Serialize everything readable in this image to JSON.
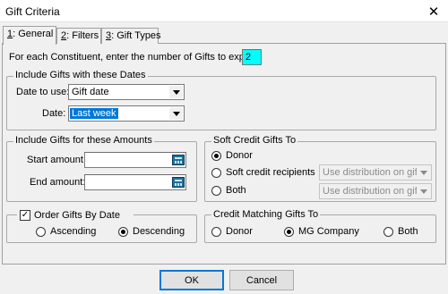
{
  "window": {
    "title": "Gift Criteria"
  },
  "tabs": [
    {
      "key": "1",
      "rest": ": General"
    },
    {
      "key": "2",
      "rest": ": Filters"
    },
    {
      "key": "3",
      "rest": ": Gift Types"
    }
  ],
  "general": {
    "export_count_label": "For each Constituent, enter the number of Gifts to export:",
    "export_count_value": "2",
    "dates": {
      "group_title": "Include Gifts with these Dates",
      "date_to_use_label": "Date to use:",
      "date_to_use_value": "Gift date",
      "date_label": "Date:",
      "date_value": "Last week"
    },
    "amounts": {
      "group_title": "Include Gifts for these Amounts",
      "start_label": "Start amount:",
      "start_value": "",
      "end_label": "End amount:",
      "end_value": ""
    },
    "soft_credit": {
      "group_title": "Soft Credit Gifts To",
      "options": [
        "Donor",
        "Soft credit recipients",
        "Both"
      ],
      "selected": "Donor",
      "distribution_value_1": "Use distribution on gift",
      "distribution_value_2": "Use distribution on gift"
    },
    "order": {
      "checkbox_label": "Order Gifts By Date",
      "checked": true,
      "ascending_label": "Ascending",
      "descending_label": "Descending",
      "selected": "Descending"
    },
    "matching": {
      "group_title": "Credit Matching Gifts To",
      "options": [
        "Donor",
        "MG Company",
        "Both"
      ],
      "selected": "MG Company"
    }
  },
  "buttons": {
    "ok": "OK",
    "cancel": "Cancel"
  }
}
